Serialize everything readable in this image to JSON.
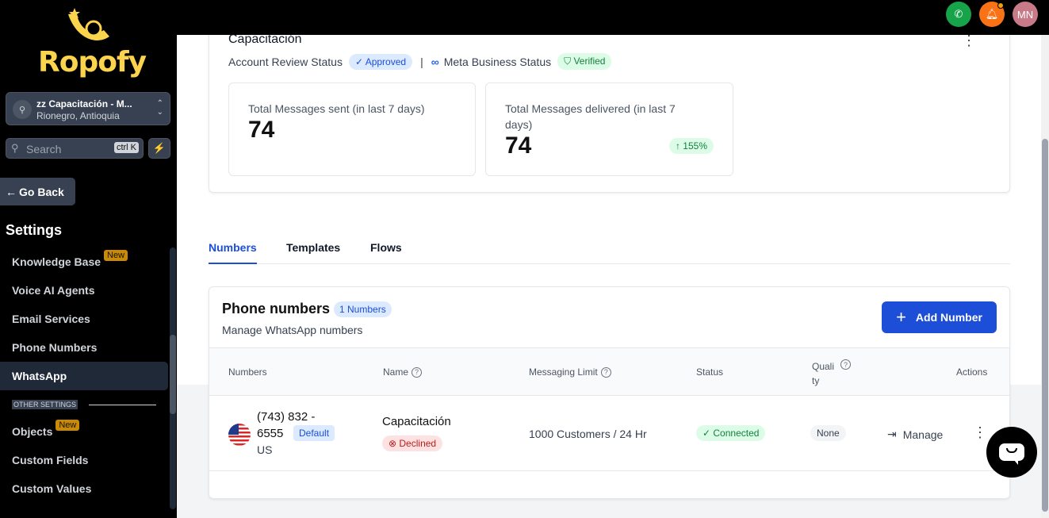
{
  "brand": {
    "name": "Ropofy"
  },
  "topbar": {
    "avatar_initials": "MN"
  },
  "sidebar": {
    "location_name": "zz Capacitación - M...",
    "location_sub": "Rionegro, Antioquia",
    "search_placeholder": "Search",
    "search_shortcut": "ctrl K",
    "go_back": "Go Back",
    "settings_title": "Settings",
    "items": [
      {
        "label": "Knowledge Base",
        "badge": "New"
      },
      {
        "label": "Voice AI Agents"
      },
      {
        "label": "Email Services"
      },
      {
        "label": "Phone Numbers"
      },
      {
        "label": "WhatsApp",
        "active": true
      },
      {
        "label": "Objects",
        "badge": "New"
      },
      {
        "label": "Custom Fields"
      },
      {
        "label": "Custom Values"
      }
    ],
    "other_settings": "OTHER SETTINGS"
  },
  "account": {
    "name": "Capacitación",
    "review_label": "Account Review Status",
    "review_status": "Approved",
    "meta_label": "Meta Business Status",
    "meta_status": "Verified"
  },
  "stats": {
    "sent_label": "Total Messages sent (in last 7 days)",
    "sent_value": "74",
    "delivered_label": "Total Messages delivered (in last 7 days)",
    "delivered_value": "74",
    "delivered_trend": "155%"
  },
  "tabs": [
    "Numbers",
    "Templates",
    "Flows"
  ],
  "phone_section": {
    "title": "Phone numbers",
    "count": "1 Numbers",
    "subtitle": "Manage WhatsApp numbers",
    "add_button": "Add Number",
    "columns": [
      "Numbers",
      "Name",
      "Messaging Limit",
      "Status",
      "Quali ty",
      "Actions"
    ],
    "rows": [
      {
        "number_line1": "(743) 832 -",
        "number_line2": "6555",
        "default_badge": "Default",
        "country": "US",
        "name": "Capacitación",
        "name_status": "Declined",
        "limit": "1000 Customers / 24 Hr",
        "status": "Connected",
        "quality": "None",
        "action": "Manage"
      }
    ]
  },
  "colors": {
    "accent": "#1d4ed8",
    "brand": "#fcd34d",
    "success": "#15803d",
    "danger": "#b91c1c"
  }
}
